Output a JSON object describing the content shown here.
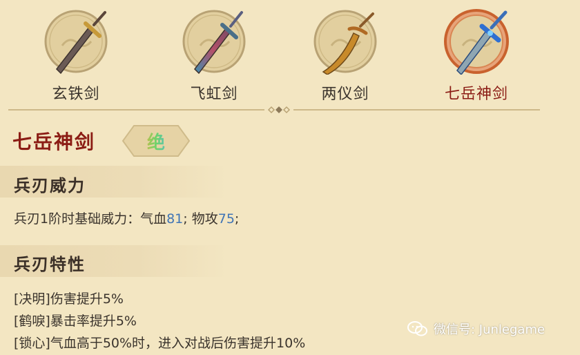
{
  "weapons": [
    {
      "name": "玄铁剑",
      "selected": false
    },
    {
      "name": "飞虹剑",
      "selected": false
    },
    {
      "name": "两仪剑",
      "selected": false
    },
    {
      "name": "七岳神剑",
      "selected": true
    }
  ],
  "detail": {
    "title": "七岳神剑",
    "grade": "绝",
    "power_section": {
      "heading": "兵刃威力",
      "text_prefix": "兵刃1阶时基础威力：气血",
      "hp_value": "81",
      "mid_text": "; 物攻",
      "atk_value": "75",
      "suffix": ";"
    },
    "traits_section": {
      "heading": "兵刃特性",
      "traits": [
        "[决明]伤害提升5%",
        "[鹤唳]暴击率提升5%",
        "[锁心]气血高于50%时，进入对战后伤害提升10%"
      ]
    }
  },
  "watermark": {
    "text": "微信号: Junlegame",
    "icon": "wechat-icon"
  },
  "colors": {
    "accent": "#8b1c14",
    "value": "#3f74b5",
    "background": "#f3e6c2"
  }
}
